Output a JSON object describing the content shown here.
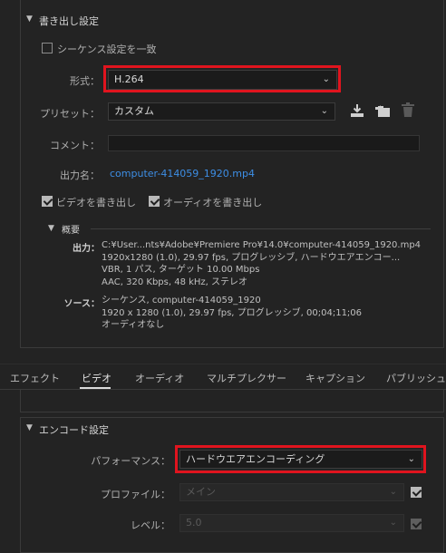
{
  "export_settings": {
    "header": "書き出し設定",
    "match_sequence_label": "シーケンス設定を一致",
    "match_sequence_checked": false,
    "format": {
      "label": "形式：",
      "value": "H.264"
    },
    "preset": {
      "label": "プリセット：",
      "value": "カスタム"
    },
    "comment": {
      "label": "コメント：",
      "value": ""
    },
    "output_name": {
      "label": "出力名：",
      "value": "computer-414059_1920.mp4"
    },
    "export_video": {
      "label": "ビデオを書き出し",
      "checked": true
    },
    "export_audio": {
      "label": "オーディオを書き出し",
      "checked": true
    },
    "summary": {
      "header": "概要",
      "output_label": "出力：",
      "output_lines": [
        "C:¥User...nts¥Adobe¥Premiere Pro¥14.0¥computer-414059_1920.mp4",
        "1920x1280 (1.0), 29.97 fps, プログレッシブ, ハードウエアエンコー...",
        "VBR, 1 パス, ターゲット 10.00 Mbps",
        "AAC, 320 Kbps, 48 kHz, ステレオ"
      ],
      "source_label": "ソース：",
      "source_lines": [
        "シーケンス, computer-414059_1920",
        "1920 x 1280 (1.0), 29.97 fps, プログレッシブ, 00;04;11;06",
        "オーディオなし"
      ]
    }
  },
  "tabs": {
    "items": [
      "エフェクト",
      "ビデオ",
      "オーディオ",
      "マルチプレクサー",
      "キャプション",
      "パブリッシュ"
    ],
    "active": "ビデオ"
  },
  "encode_settings": {
    "header": "エンコード設定",
    "performance": {
      "label": "パフォーマンス：",
      "value": "ハードウエアエンコーディング"
    },
    "profile": {
      "label": "プロファイル：",
      "value": "メイン",
      "checked": true
    },
    "level": {
      "label": "レベル：",
      "value": "5.0",
      "checked": true
    }
  },
  "colors": {
    "background": "#232323",
    "highlight": "#e0141e",
    "link": "#3d8ee5"
  },
  "icons": [
    "download-preset-icon",
    "import-preset-icon",
    "delete-preset-icon",
    "chevron-down-icon"
  ]
}
